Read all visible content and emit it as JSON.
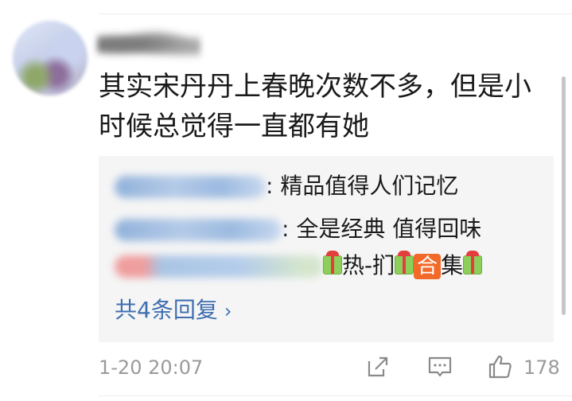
{
  "comment": {
    "text": "其实宋丹丹上春晚次数不多，但是小时候总觉得一直都有她",
    "time": "1-20 20:07",
    "like_count": "178"
  },
  "replies": [
    {
      "text": ": 精品值得人们记忆"
    },
    {
      "text": ": 全是经典 值得回味"
    },
    {
      "prefix": "热-扪",
      "badge": "合",
      "suffix": "集"
    }
  ],
  "more_replies": {
    "label": "共4条回复",
    "chevron": "›"
  },
  "icons": [
    "share-icon",
    "comment-icon",
    "like-icon",
    "gift-emoji-icon",
    "chevron-right-icon"
  ],
  "colors": {
    "link": "#3f6fb0",
    "badge": "#f26a2a",
    "muted": "#9a9a9a",
    "reply_bg": "#f5f5f5"
  }
}
